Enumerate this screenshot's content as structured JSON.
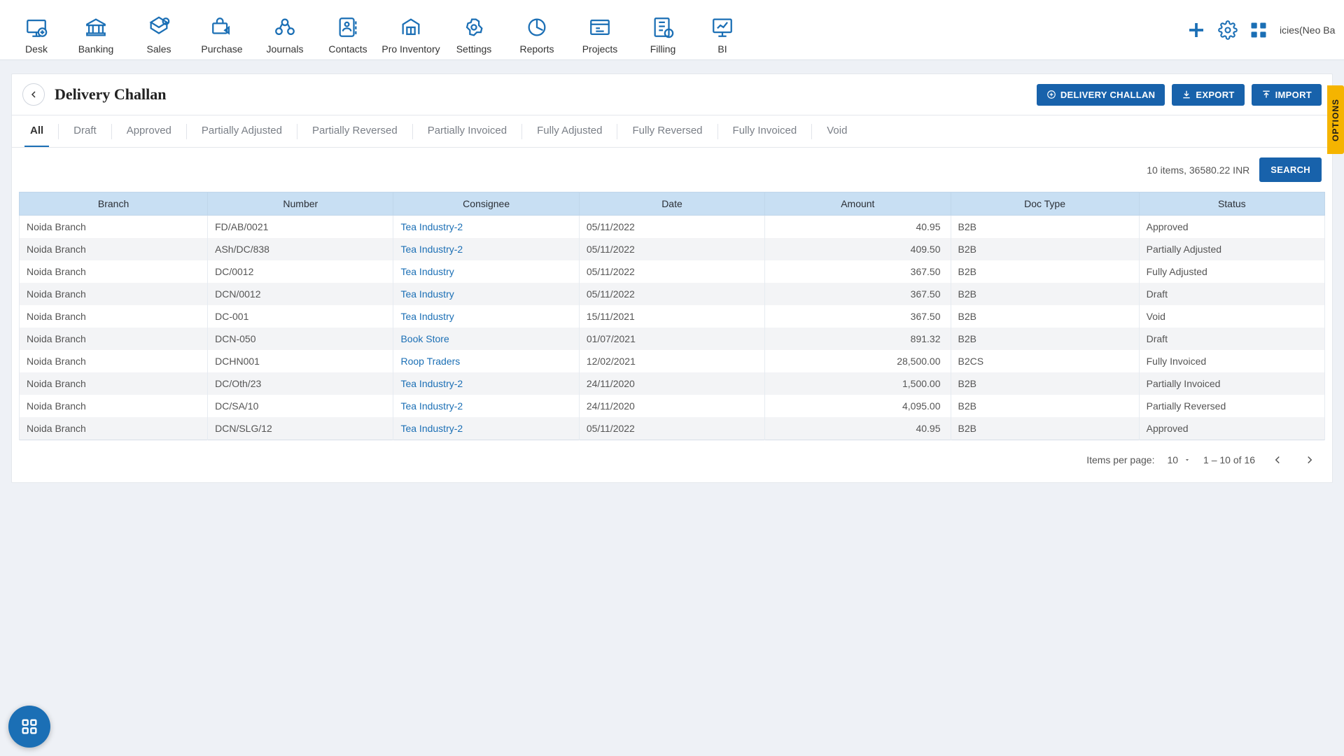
{
  "topnav": [
    {
      "label": "Desk",
      "icon": "desk"
    },
    {
      "label": "Banking",
      "icon": "bank"
    },
    {
      "label": "Sales",
      "icon": "sales"
    },
    {
      "label": "Purchase",
      "icon": "purchase"
    },
    {
      "label": "Journals",
      "icon": "journals"
    },
    {
      "label": "Contacts",
      "icon": "contacts"
    },
    {
      "label": "Pro Inventory",
      "icon": "inventory"
    },
    {
      "label": "Settings",
      "icon": "settings"
    },
    {
      "label": "Reports",
      "icon": "reports"
    },
    {
      "label": "Projects",
      "icon": "projects"
    },
    {
      "label": "Filling",
      "icon": "filling"
    },
    {
      "label": "BI",
      "icon": "bi"
    }
  ],
  "company_label": "icies(Neo Bai",
  "page_title": "Delivery Challan",
  "header_buttons": {
    "newLabel": "DELIVERY CHALLAN",
    "exportLabel": "EXPORT",
    "importLabel": "IMPORT"
  },
  "tabs": [
    "All",
    "Draft",
    "Approved",
    "Partially Adjusted",
    "Partially Reversed",
    "Partially Invoiced",
    "Fully Adjusted",
    "Fully Reversed",
    "Fully Invoiced",
    "Void"
  ],
  "active_tab": "All",
  "summary": "10 items, 36580.22 INR",
  "search_label": "SEARCH",
  "columns": [
    "Branch",
    "Number",
    "Consignee",
    "Date",
    "Amount",
    "Doc Type",
    "Status"
  ],
  "rows": [
    {
      "branch": "Noida Branch",
      "number": "FD/AB/0021",
      "consignee": "Tea Industry-2",
      "date": "05/11/2022",
      "amount": "40.95",
      "doc": "B2B",
      "status": "Approved"
    },
    {
      "branch": "Noida Branch",
      "number": "ASh/DC/838",
      "consignee": "Tea Industry-2",
      "date": "05/11/2022",
      "amount": "409.50",
      "doc": "B2B",
      "status": "Partially Adjusted"
    },
    {
      "branch": "Noida Branch",
      "number": "DC/0012",
      "consignee": "Tea Industry",
      "date": "05/11/2022",
      "amount": "367.50",
      "doc": "B2B",
      "status": "Fully Adjusted"
    },
    {
      "branch": "Noida Branch",
      "number": "DCN/0012",
      "consignee": "Tea Industry",
      "date": "05/11/2022",
      "amount": "367.50",
      "doc": "B2B",
      "status": "Draft"
    },
    {
      "branch": "Noida Branch",
      "number": "DC-001",
      "consignee": "Tea Industry",
      "date": "15/11/2021",
      "amount": "367.50",
      "doc": "B2B",
      "status": "Void"
    },
    {
      "branch": "Noida Branch",
      "number": "DCN-050",
      "consignee": "Book Store",
      "date": "01/07/2021",
      "amount": "891.32",
      "doc": "B2B",
      "status": "Draft"
    },
    {
      "branch": "Noida Branch",
      "number": "DCHN001",
      "consignee": "Roop Traders",
      "date": "12/02/2021",
      "amount": "28,500.00",
      "doc": "B2CS",
      "status": "Fully Invoiced"
    },
    {
      "branch": "Noida Branch",
      "number": "DC/Oth/23",
      "consignee": "Tea Industry-2",
      "date": "24/11/2020",
      "amount": "1,500.00",
      "doc": "B2B",
      "status": "Partially Invoiced"
    },
    {
      "branch": "Noida Branch",
      "number": "DC/SA/10",
      "consignee": "Tea Industry-2",
      "date": "24/11/2020",
      "amount": "4,095.00",
      "doc": "B2B",
      "status": "Partially Reversed"
    },
    {
      "branch": "Noida Branch",
      "number": "DCN/SLG/12",
      "consignee": "Tea Industry-2",
      "date": "05/11/2022",
      "amount": "40.95",
      "doc": "B2B",
      "status": "Approved"
    }
  ],
  "pager": {
    "itemsPerPageLabel": "Items per page:",
    "perPageValue": "10",
    "rangeLabel": "1 – 10 of 16"
  },
  "options_tab_label": "OPTIONS"
}
